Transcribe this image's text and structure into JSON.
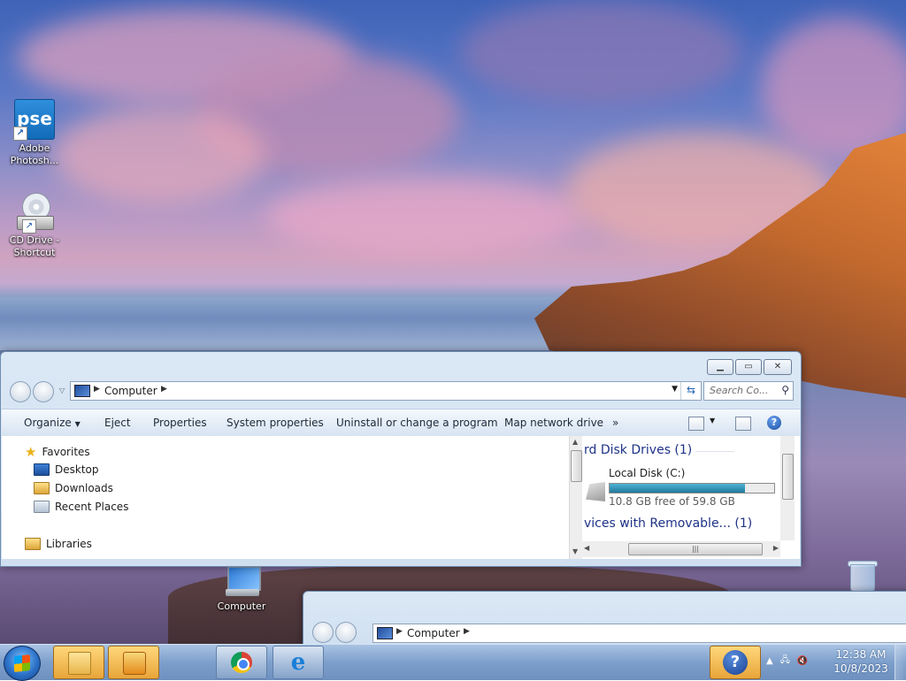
{
  "desktop": {
    "icons": [
      {
        "label": "Adobe Photosh...",
        "glyph": "pse"
      },
      {
        "label": "CD Drive - Shortcut"
      },
      {
        "label": "Computer"
      },
      {
        "label": ""
      }
    ]
  },
  "explorer": {
    "address": {
      "crumb": "Computer"
    },
    "search": {
      "placeholder": "Search Co..."
    },
    "toolbar": {
      "organize": "Organize",
      "eject": "Eject",
      "properties": "Properties",
      "system_properties": "System properties",
      "uninstall": "Uninstall or change a program",
      "map_drive": "Map network drive",
      "more": "»"
    },
    "nav": {
      "favorites": "Favorites",
      "desktop": "Desktop",
      "downloads": "Downloads",
      "recent": "Recent Places",
      "libraries": "Libraries"
    },
    "main": {
      "hdd_group": "rd Disk Drives (1)",
      "drive_name": "Local Disk (C:)",
      "drive_free": "10.8 GB free of 59.8 GB",
      "drive_used_fraction": 0.82,
      "removable_group": "vices with Removable... (1)"
    }
  },
  "explorer2": {
    "address": {
      "crumb": "Computer"
    }
  },
  "taskbar": {
    "time": "12:38 AM",
    "date": "10/8/2023"
  },
  "colors": {
    "accent": "#1e3287",
    "bar_fill": "#21799b"
  }
}
